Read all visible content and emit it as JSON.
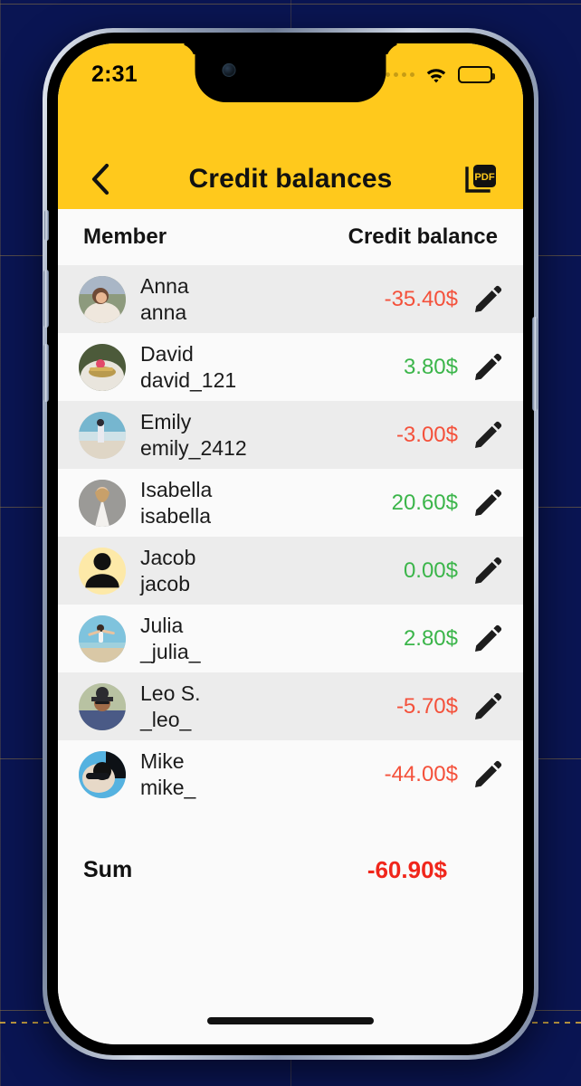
{
  "status_bar": {
    "time": "2:31",
    "signal_icon": "signal-dots-icon",
    "wifi_icon": "wifi-icon",
    "battery_icon": "battery-icon"
  },
  "nav": {
    "back_icon": "chevron-left-icon",
    "title": "Credit balances",
    "pdf_label": "PDF",
    "pdf_icon": "pdf-export-icon"
  },
  "table": {
    "col_member": "Member",
    "col_balance": "Credit balance",
    "edit_icon": "pencil-icon",
    "rows": [
      {
        "name": "Anna",
        "handle": "anna",
        "balance": "-35.40$",
        "sign": "neg",
        "avatar": "photo"
      },
      {
        "name": "David",
        "handle": "david_121",
        "balance": "3.80$",
        "sign": "pos",
        "avatar": "photo"
      },
      {
        "name": "Emily",
        "handle": "emily_2412",
        "balance": "-3.00$",
        "sign": "neg",
        "avatar": "photo"
      },
      {
        "name": "Isabella",
        "handle": "isabella",
        "balance": "20.60$",
        "sign": "pos",
        "avatar": "photo"
      },
      {
        "name": "Jacob",
        "handle": "jacob",
        "balance": "0.00$",
        "sign": "pos",
        "avatar": "placeholder"
      },
      {
        "name": "Julia",
        "handle": "_julia_",
        "balance": "2.80$",
        "sign": "pos",
        "avatar": "photo"
      },
      {
        "name": "Leo S.",
        "handle": "_leo_",
        "balance": "-5.70$",
        "sign": "neg",
        "avatar": "photo"
      },
      {
        "name": "Mike",
        "handle": "mike_",
        "balance": "-44.00$",
        "sign": "neg",
        "avatar": "photo"
      }
    ]
  },
  "summary": {
    "label": "Sum",
    "value": "-60.90$"
  },
  "colors": {
    "brand_yellow": "#FFC91C",
    "negative": "#F4513B",
    "positive": "#3BB54A",
    "sum_negative": "#F0261B",
    "row_odd": "#ececec",
    "row_even": "#fafafa",
    "backdrop": "#0a1553"
  }
}
